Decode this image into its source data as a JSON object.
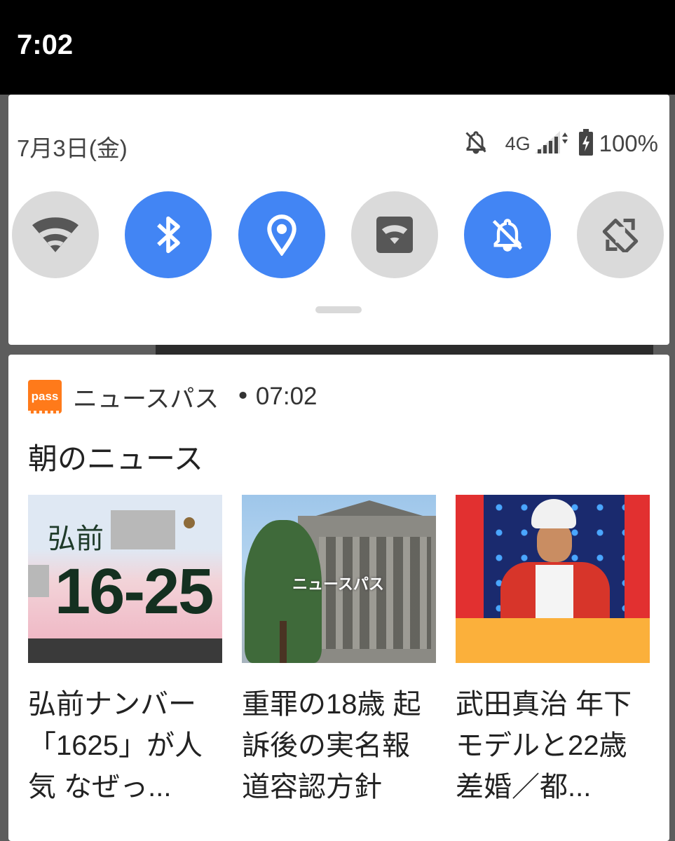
{
  "status_bar": {
    "time": "7:02"
  },
  "quick_settings": {
    "date": "7月3日(金)",
    "network_type": "4G",
    "battery_percent": "100%",
    "tiles": [
      {
        "name": "Wi-Fi",
        "state": "off",
        "icon": "wifi-icon"
      },
      {
        "name": "Bluetooth",
        "state": "on",
        "icon": "bluetooth-icon"
      },
      {
        "name": "Location",
        "state": "on",
        "icon": "location-icon"
      },
      {
        "name": "Hotspot",
        "state": "off",
        "icon": "hotspot-icon"
      },
      {
        "name": "Do not disturb",
        "state": "on",
        "icon": "bell-off-icon"
      },
      {
        "name": "Auto-rotate",
        "state": "off",
        "icon": "rotate-icon"
      }
    ]
  },
  "notification": {
    "app_icon_label": "pass",
    "app_name": "ニュースパス",
    "separator": "•",
    "time": "07:02",
    "title": "朝のニュース",
    "articles": [
      {
        "plate_region": "弘前",
        "plate_number": "16-25",
        "headline": "弘前ナンバー「1625」が人気 なぜっ..."
      },
      {
        "watermark": "ニュースパス",
        "headline": "重罪の18歳 起訴後の実名報道容認方針"
      },
      {
        "headline": "武田真治 年下モデルと22歳差婚／都..."
      }
    ]
  },
  "colors": {
    "tile_on": "#4285f4",
    "tile_off": "#dadada",
    "app_accent": "#ff7a1a"
  }
}
